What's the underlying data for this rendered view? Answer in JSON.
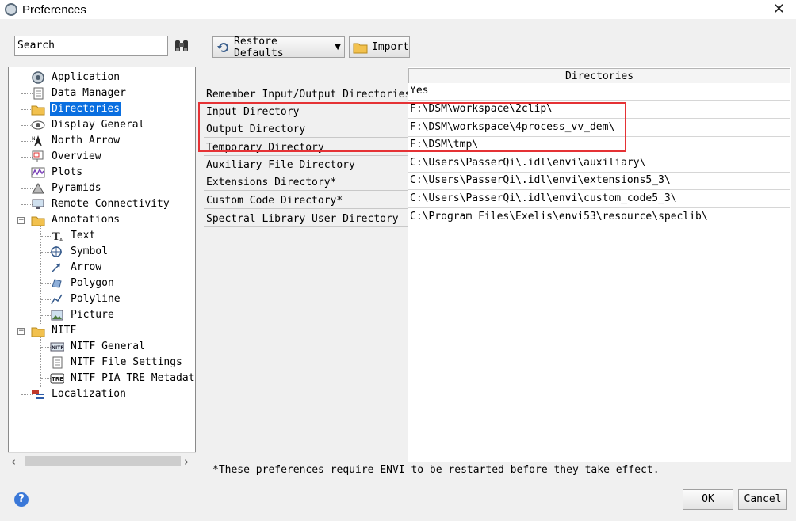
{
  "window": {
    "title": "Preferences",
    "close_icon": "close-icon"
  },
  "search": {
    "value": "Search"
  },
  "toolbar": {
    "restore_label": "Restore Defaults",
    "import_label": "Import"
  },
  "tree": {
    "items": [
      {
        "label": "Application"
      },
      {
        "label": "Data Manager"
      },
      {
        "label": "Directories"
      },
      {
        "label": "Display General"
      },
      {
        "label": "North Arrow"
      },
      {
        "label": "Overview"
      },
      {
        "label": "Plots"
      },
      {
        "label": "Pyramids"
      },
      {
        "label": "Remote Connectivity"
      },
      {
        "label": "Annotations"
      },
      {
        "label": "Text"
      },
      {
        "label": "Symbol"
      },
      {
        "label": "Arrow"
      },
      {
        "label": "Polygon"
      },
      {
        "label": "Polyline"
      },
      {
        "label": "Picture"
      },
      {
        "label": "NITF"
      },
      {
        "label": "NITF General"
      },
      {
        "label": "NITF File Settings"
      },
      {
        "label": "NITF PIA TRE Metadata"
      },
      {
        "label": "Localization"
      }
    ]
  },
  "table": {
    "header": "Directories",
    "rows": [
      {
        "name": "Remember Input/Output Directories",
        "value": "Yes"
      },
      {
        "name": "Input Directory",
        "value": "F:\\DSM\\workspace\\2clip\\"
      },
      {
        "name": "Output Directory",
        "value": "F:\\DSM\\workspace\\4process_vv_dem\\"
      },
      {
        "name": "Temporary Directory",
        "value": "F:\\DSM\\tmp\\"
      },
      {
        "name": "Auxiliary File Directory",
        "value": "C:\\Users\\PasserQi\\.idl\\envi\\auxiliary\\"
      },
      {
        "name": "Extensions Directory*",
        "value": "C:\\Users\\PasserQi\\.idl\\envi\\extensions5_3\\"
      },
      {
        "name": "Custom Code Directory*",
        "value": "C:\\Users\\PasserQi\\.idl\\envi\\custom_code5_3\\"
      },
      {
        "name": "Spectral Library User Directory",
        "value": "C:\\Program Files\\Exelis\\envi53\\resource\\speclib\\"
      }
    ]
  },
  "note": "*These preferences require ENVI to be restarted before they take effect.",
  "buttons": {
    "ok": "OK",
    "cancel": "Cancel"
  },
  "colors": {
    "selection": "#0a6fe0",
    "highlight_box": "#e53235"
  }
}
